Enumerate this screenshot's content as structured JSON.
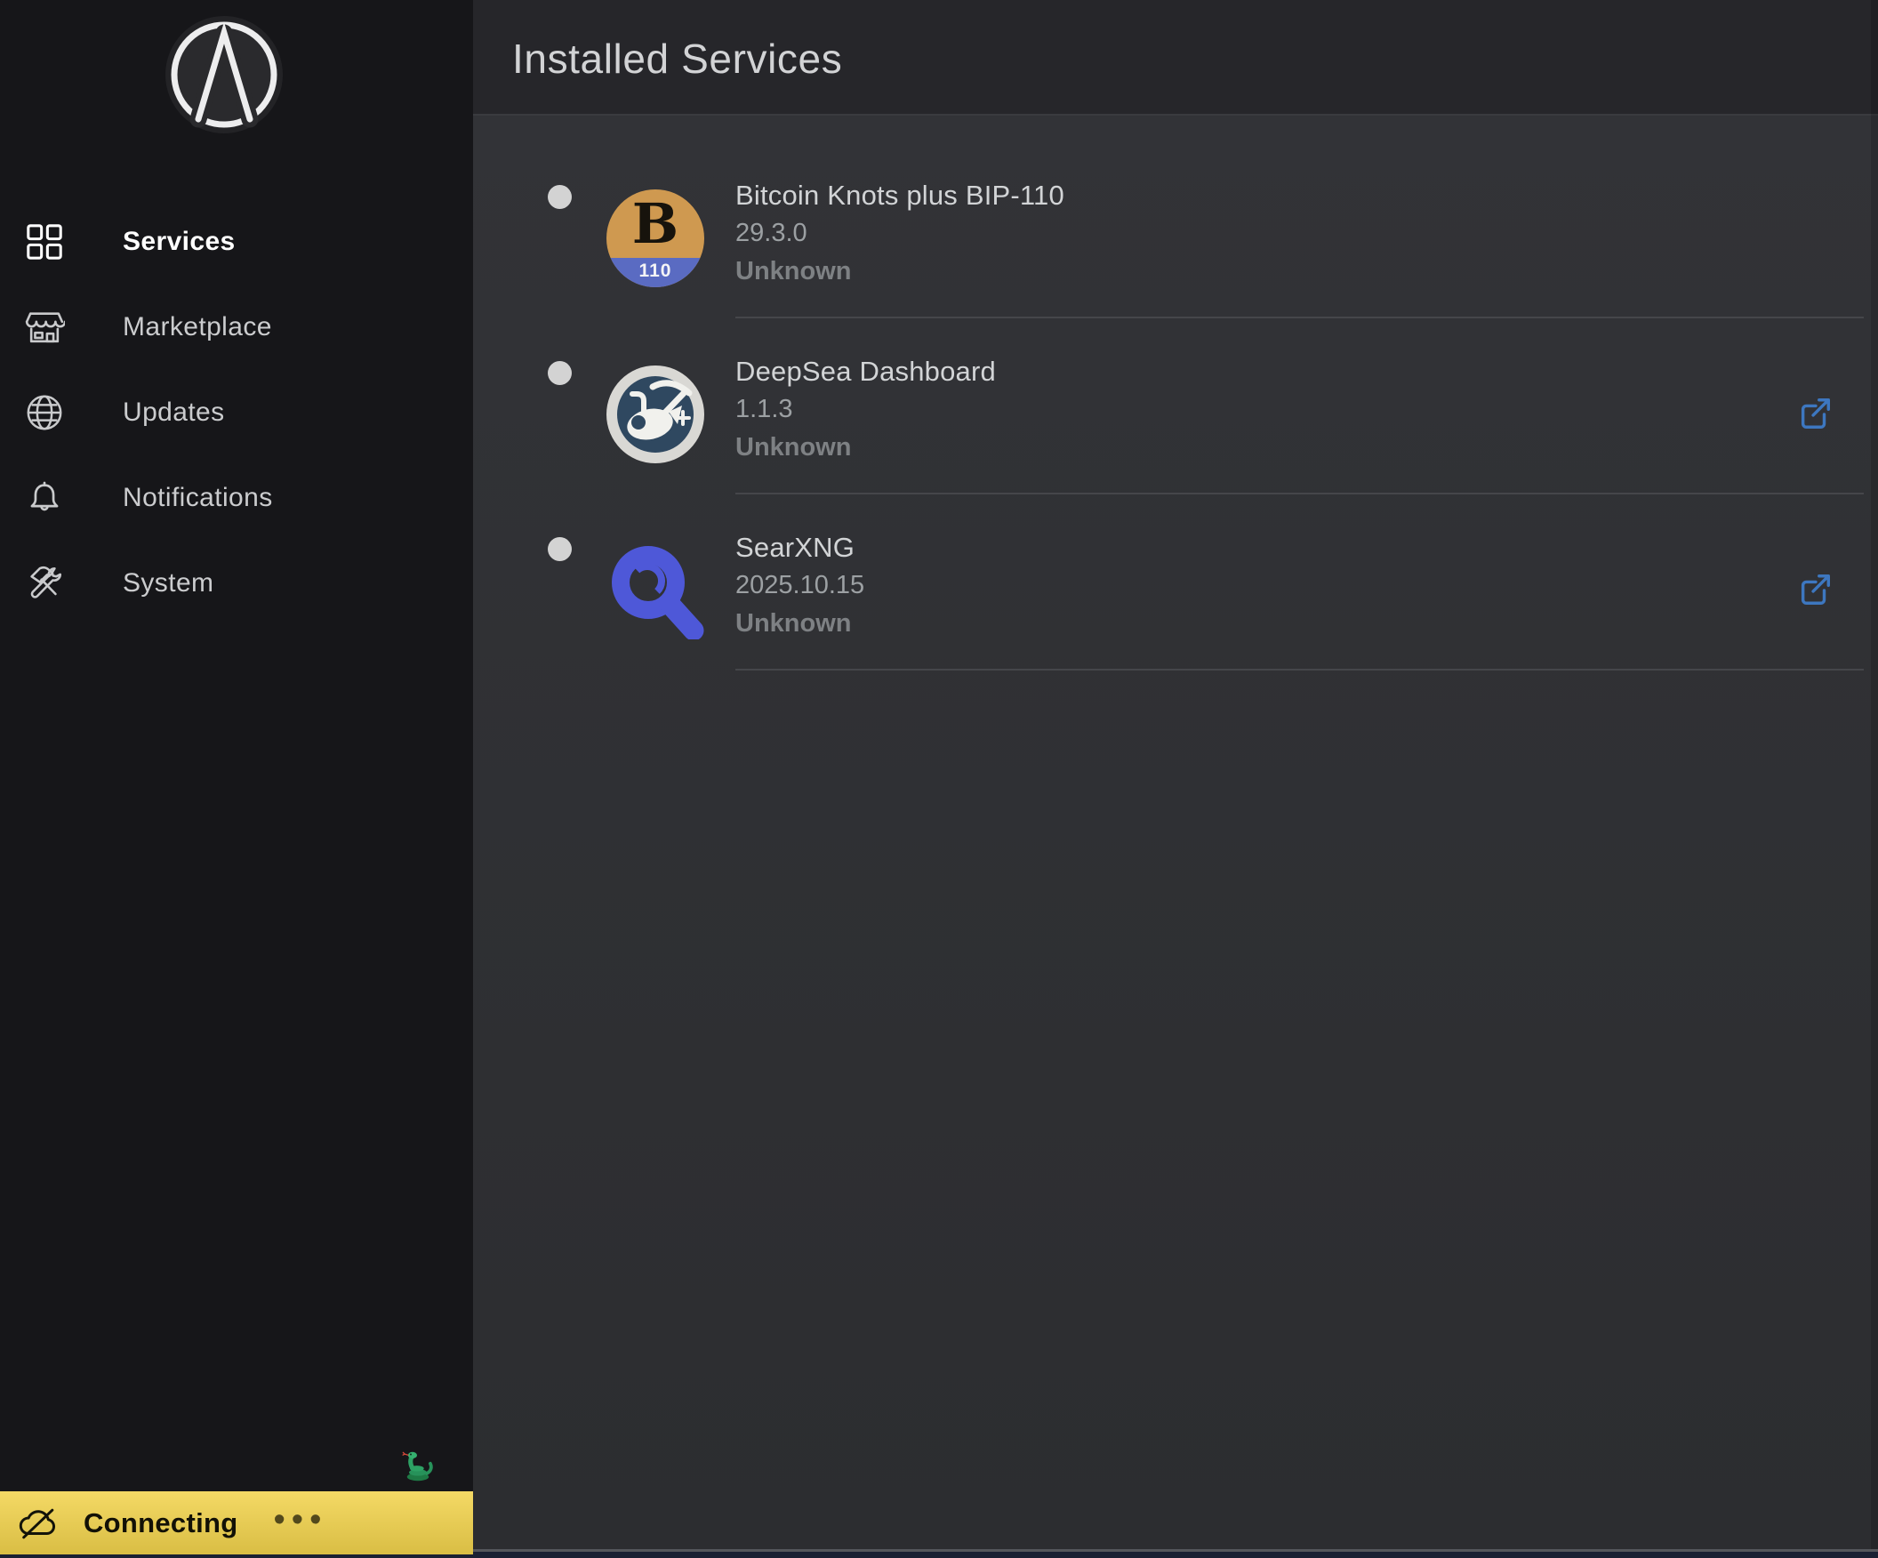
{
  "sidebar": {
    "items": [
      {
        "label": "Services",
        "icon": "grid-icon",
        "active": true
      },
      {
        "label": "Marketplace",
        "icon": "storefront-icon",
        "active": false
      },
      {
        "label": "Updates",
        "icon": "globe-icon",
        "active": false
      },
      {
        "label": "Notifications",
        "icon": "bell-icon",
        "active": false
      },
      {
        "label": "System",
        "icon": "tools-icon",
        "active": false
      }
    ]
  },
  "header": {
    "title": "Installed Services"
  },
  "services": [
    {
      "name": "Bitcoin Knots plus BIP-110",
      "version": "29.3.0",
      "status": "Unknown",
      "badge": "110",
      "has_external_link": false
    },
    {
      "name": "DeepSea Dashboard",
      "version": "1.1.3",
      "status": "Unknown",
      "has_external_link": true
    },
    {
      "name": "SearXNG",
      "version": "2025.10.15",
      "status": "Unknown",
      "has_external_link": true
    }
  ],
  "statusbar": {
    "label": "Connecting",
    "ellipsis": "•••"
  },
  "colors": {
    "accent_yellow": "#f2d34c",
    "link_blue": "#3d77c0",
    "searx_blue": "#4e58d8",
    "knots_orange": "#cf9950",
    "knots_band": "#5a6bc2",
    "deepsea_ring": "#d9d8d4",
    "deepsea_navy": "#2f4860",
    "status_dot": "#d3d3d3"
  }
}
